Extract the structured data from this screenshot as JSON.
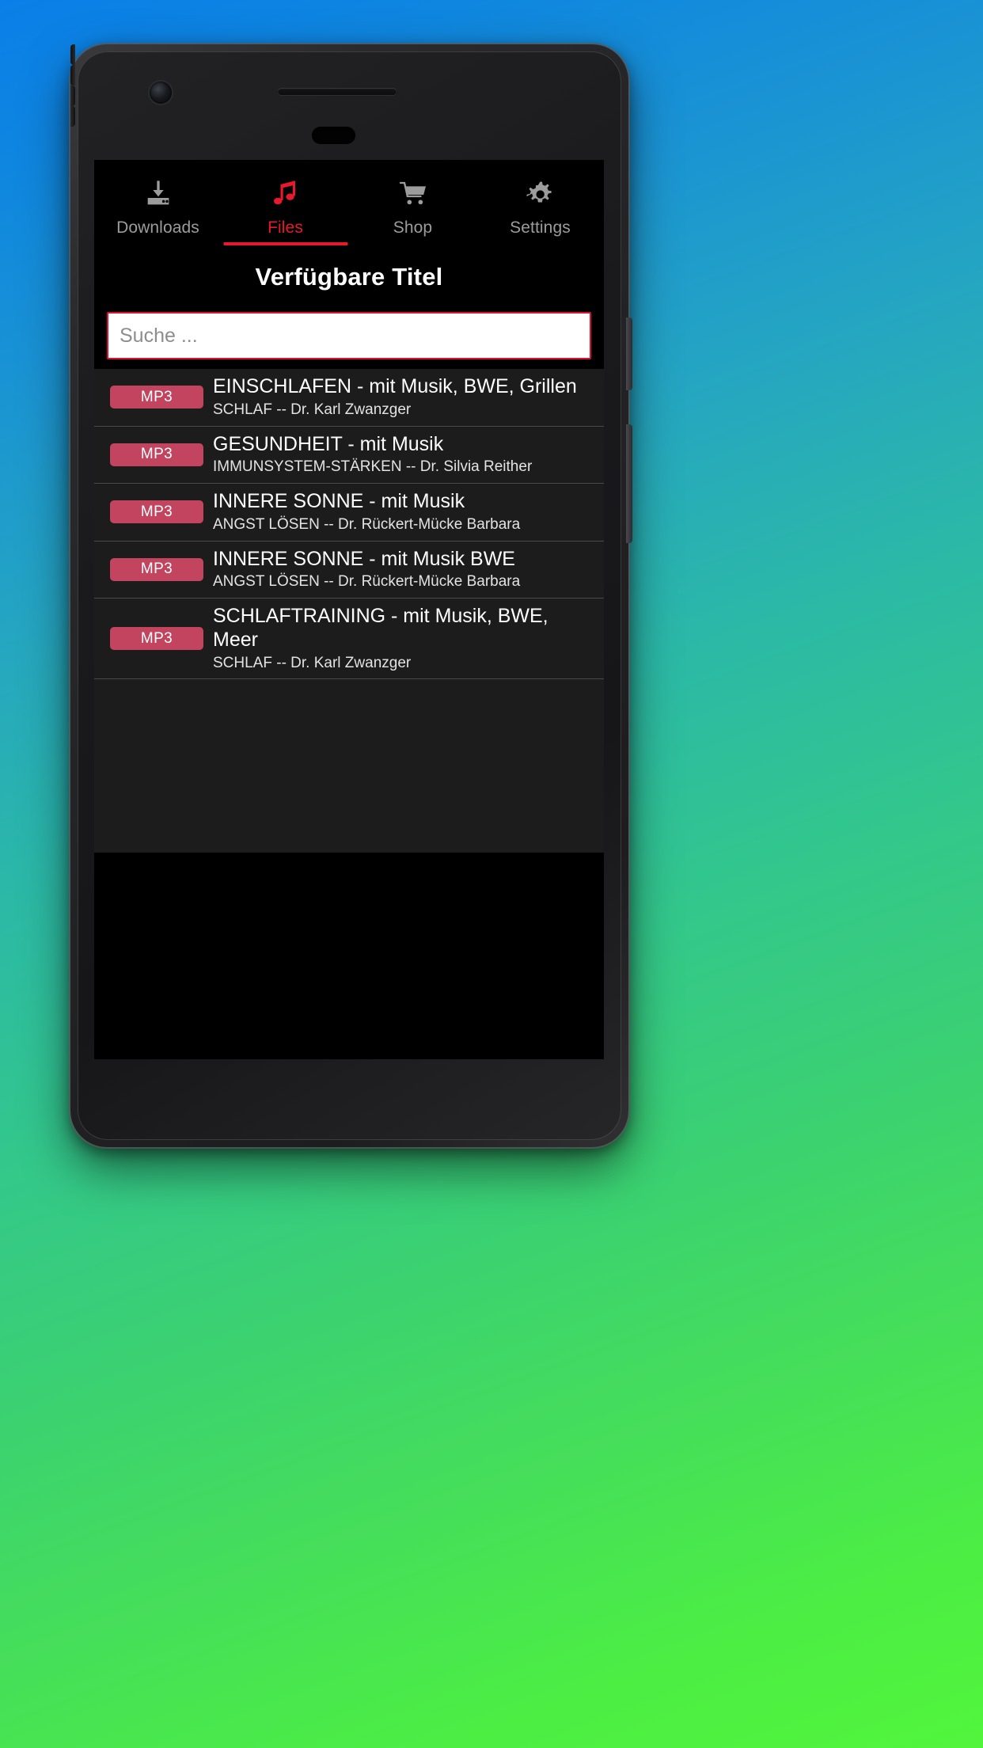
{
  "tabs": [
    {
      "label": "Downloads",
      "icon": "download-icon",
      "active": false
    },
    {
      "label": "Files",
      "icon": "music-note-icon",
      "active": true
    },
    {
      "label": "Shop",
      "icon": "shopping-cart-icon",
      "active": false
    },
    {
      "label": "Settings",
      "icon": "gear-icon",
      "active": false
    }
  ],
  "header": {
    "title": "Verfügbare Titel"
  },
  "search": {
    "placeholder": "Suche ...",
    "value": ""
  },
  "colors": {
    "accent_red": "#e8192c",
    "badge_rose": "#c2445f",
    "screen_bg": "#000000",
    "list_bg": "#1c1c1c",
    "divider": "#4a4a4a",
    "inactive_tab": "#9c9c9c"
  },
  "list": {
    "items": [
      {
        "badge": "MP3",
        "title": "EINSCHLAFEN - mit Musik, BWE, Grillen",
        "subtitle": "SCHLAF -- Dr. Karl Zwanzger"
      },
      {
        "badge": "MP3",
        "title": "GESUNDHEIT - mit Musik",
        "subtitle": "IMMUNSYSTEM-STÄRKEN -- Dr. Silvia Reither"
      },
      {
        "badge": "MP3",
        "title": "INNERE SONNE - mit Musik",
        "subtitle": "ANGST LÖSEN -- Dr. Rückert-Mücke Barbara"
      },
      {
        "badge": "MP3",
        "title": "INNERE SONNE - mit Musik BWE",
        "subtitle": "ANGST LÖSEN -- Dr. Rückert-Mücke Barbara"
      },
      {
        "badge": "MP3",
        "title": "SCHLAFTRAINING - mit Musik, BWE, Meer",
        "subtitle": "SCHLAF -- Dr. Karl Zwanzger"
      }
    ]
  }
}
